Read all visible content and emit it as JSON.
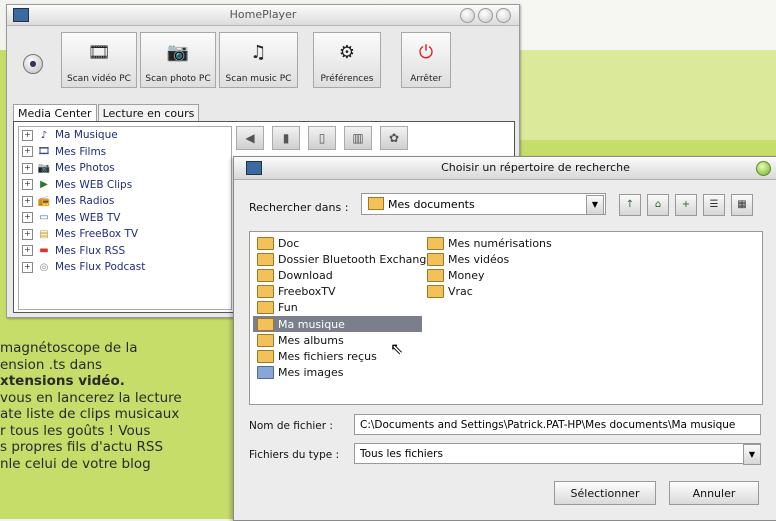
{
  "homeplayer": {
    "title": "HomePlayer",
    "toolbar": [
      {
        "label": "Scan vidéo PC",
        "icon": "scan-video-icon",
        "glyph": "🎞"
      },
      {
        "label": "Scan photo PC",
        "icon": "scan-photo-icon",
        "glyph": "📷"
      },
      {
        "label": "Scan music PC",
        "icon": "scan-music-icon",
        "glyph": "♫"
      },
      {
        "label": "Préférences",
        "icon": "preferences-icon",
        "glyph": "⚙"
      },
      {
        "label": "Arrêter",
        "icon": "stop-icon",
        "glyph": "⏻"
      }
    ],
    "tabs": [
      "Media Center",
      "Lecture en cours"
    ],
    "tree": [
      {
        "label": "Ma Musique",
        "icon": "music-note-icon",
        "glyph": "♪"
      },
      {
        "label": "Mes Films",
        "icon": "film-icon",
        "glyph": "🎞"
      },
      {
        "label": "Mes Photos",
        "icon": "camera-icon",
        "glyph": "📷"
      },
      {
        "label": "Mes WEB Clips",
        "icon": "web-clips-icon",
        "glyph": "▶"
      },
      {
        "label": "Mes Radios",
        "icon": "radio-icon",
        "glyph": "📻"
      },
      {
        "label": "Mes WEB TV",
        "icon": "tv-icon",
        "glyph": "▭"
      },
      {
        "label": "Mes FreeBox TV",
        "icon": "freebox-icon",
        "glyph": "▤"
      },
      {
        "label": "Mes Flux RSS",
        "icon": "rss-icon",
        "glyph": "▬"
      },
      {
        "label": "Mes Flux Podcast",
        "icon": "podcast-icon",
        "glyph": "◎"
      }
    ]
  },
  "dialog": {
    "title": "Choisir un répertoire de recherche",
    "look_in_label": "Rechercher dans :",
    "look_in_value": "Mes documents",
    "files_col1": [
      "Doc",
      "Dossier Bluetooth Exchange",
      "Download",
      "FreeboxTV",
      "Fun",
      "Ma musique",
      "Mes albums",
      "Mes fichiers reçus",
      "Mes images"
    ],
    "files_col2": [
      "Mes numérisations",
      "Mes vidéos",
      "Money",
      "Vrac"
    ],
    "selected": "Ma musique",
    "filename_label": "Nom de fichier :",
    "filename_value": "C:\\Documents and Settings\\Patrick.PAT-HP\\Mes documents\\Ma musique",
    "filetype_label": "Fichiers du type :",
    "filetype_value": "Tous les fichiers",
    "select_button": "Sélectionner",
    "cancel_button": "Annuler"
  },
  "article_lines": [
    "magnétoscope de la",
    "ension .ts dans",
    "xtensions vidéo.",
    "vous en lancerez la lecture",
    "ate liste de clips musicaux",
    "r tous les goûts ! Vous",
    "s propres fils d'actu RSS",
    "nle celui de votre blog"
  ],
  "colors": {
    "selection": "#7b7f8c",
    "magazine_green": "#c6dd6a"
  }
}
